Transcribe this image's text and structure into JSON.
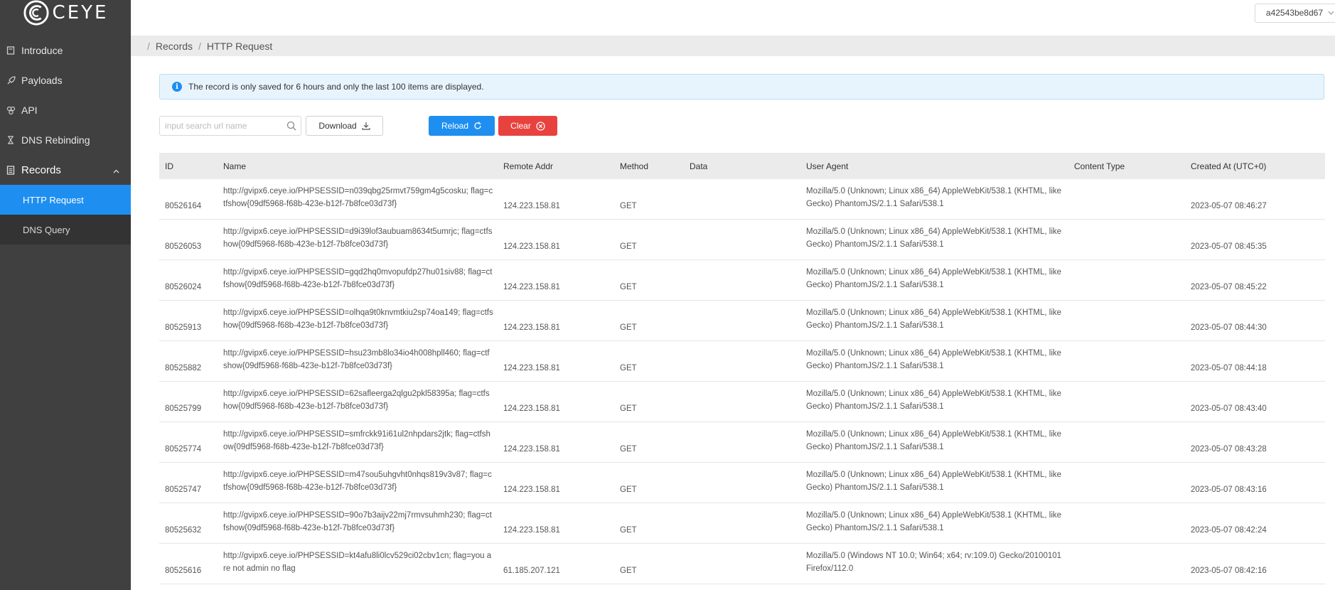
{
  "brand": {
    "name": "CEYE"
  },
  "sidebar": {
    "items": [
      {
        "label": "Introduce",
        "icon": "book-icon"
      },
      {
        "label": "Payloads",
        "icon": "rocket-icon"
      },
      {
        "label": "API",
        "icon": "api-icon"
      },
      {
        "label": "DNS Rebinding",
        "icon": "hourglass-icon"
      }
    ],
    "group": {
      "label": "Records",
      "icon": "records-icon",
      "expanded": true,
      "children": [
        {
          "label": "HTTP Request",
          "active": true
        },
        {
          "label": "DNS Query",
          "active": false
        }
      ]
    }
  },
  "header": {
    "user": "a42543be8d67"
  },
  "breadcrumb": {
    "sep": "/",
    "items": [
      "Records",
      "HTTP Request"
    ]
  },
  "alert": {
    "text": "The record is only saved for 6 hours and only the last 100 items are displayed."
  },
  "toolbar": {
    "search_placeholder": "input search url name",
    "download_label": "Download",
    "reload_label": "Reload",
    "clear_label": "Clear"
  },
  "colors": {
    "accent": "#1e8ff0",
    "danger": "#e8423e",
    "sidebar": "#404040"
  },
  "table": {
    "columns": [
      "ID",
      "Name",
      "Remote Addr",
      "Method",
      "Data",
      "User Agent",
      "Content Type",
      "Created At (UTC+0)"
    ],
    "rows": [
      {
        "id": "80526164",
        "name": "http://gvipx6.ceye.io/PHPSESSID=n039qbg25rmvt759gm4g5cosku; flag=ctfshow{09df5968-f68b-423e-b12f-7b8fce03d73f}",
        "addr": "124.223.158.81",
        "method": "GET",
        "data": "",
        "ua": "Mozilla/5.0 (Unknown; Linux x86_64) AppleWebKit/538.1 (KHTML, like Gecko) PhantomJS/2.1.1 Safari/538.1",
        "ct": "",
        "created": "2023-05-07 08:46:27"
      },
      {
        "id": "80526053",
        "name": "http://gvipx6.ceye.io/PHPSESSID=d9i39lof3aubuam8634t5umrjc; flag=ctfshow{09df5968-f68b-423e-b12f-7b8fce03d73f}",
        "addr": "124.223.158.81",
        "method": "GET",
        "data": "",
        "ua": "Mozilla/5.0 (Unknown; Linux x86_64) AppleWebKit/538.1 (KHTML, like Gecko) PhantomJS/2.1.1 Safari/538.1",
        "ct": "",
        "created": "2023-05-07 08:45:35"
      },
      {
        "id": "80526024",
        "name": "http://gvipx6.ceye.io/PHPSESSID=gqd2hq0mvopufdp27hu01siv88; flag=ctfshow{09df5968-f68b-423e-b12f-7b8fce03d73f}",
        "addr": "124.223.158.81",
        "method": "GET",
        "data": "",
        "ua": "Mozilla/5.0 (Unknown; Linux x86_64) AppleWebKit/538.1 (KHTML, like Gecko) PhantomJS/2.1.1 Safari/538.1",
        "ct": "",
        "created": "2023-05-07 08:45:22"
      },
      {
        "id": "80525913",
        "name": "http://gvipx6.ceye.io/PHPSESSID=olhqa9t0knvmtkiu2sp74oa149; flag=ctfshow{09df5968-f68b-423e-b12f-7b8fce03d73f}",
        "addr": "124.223.158.81",
        "method": "GET",
        "data": "",
        "ua": "Mozilla/5.0 (Unknown; Linux x86_64) AppleWebKit/538.1 (KHTML, like Gecko) PhantomJS/2.1.1 Safari/538.1",
        "ct": "",
        "created": "2023-05-07 08:44:30"
      },
      {
        "id": "80525882",
        "name": "http://gvipx6.ceye.io/PHPSESSID=hsu23mb8lo34io4h008hpll460; flag=ctfshow{09df5968-f68b-423e-b12f-7b8fce03d73f}",
        "addr": "124.223.158.81",
        "method": "GET",
        "data": "",
        "ua": "Mozilla/5.0 (Unknown; Linux x86_64) AppleWebKit/538.1 (KHTML, like Gecko) PhantomJS/2.1.1 Safari/538.1",
        "ct": "",
        "created": "2023-05-07 08:44:18"
      },
      {
        "id": "80525799",
        "name": "http://gvipx6.ceye.io/PHPSESSID=62safleerga2qlgu2pkl58395a; flag=ctfshow{09df5968-f68b-423e-b12f-7b8fce03d73f}",
        "addr": "124.223.158.81",
        "method": "GET",
        "data": "",
        "ua": "Mozilla/5.0 (Unknown; Linux x86_64) AppleWebKit/538.1 (KHTML, like Gecko) PhantomJS/2.1.1 Safari/538.1",
        "ct": "",
        "created": "2023-05-07 08:43:40"
      },
      {
        "id": "80525774",
        "name": "http://gvipx6.ceye.io/PHPSESSID=smfrckk91i61ul2nhpdars2jtk; flag=ctfshow{09df5968-f68b-423e-b12f-7b8fce03d73f}",
        "addr": "124.223.158.81",
        "method": "GET",
        "data": "",
        "ua": "Mozilla/5.0 (Unknown; Linux x86_64) AppleWebKit/538.1 (KHTML, like Gecko) PhantomJS/2.1.1 Safari/538.1",
        "ct": "",
        "created": "2023-05-07 08:43:28"
      },
      {
        "id": "80525747",
        "name": "http://gvipx6.ceye.io/PHPSESSID=m47sou5uhgvht0nhqs819v3v87; flag=ctfshow{09df5968-f68b-423e-b12f-7b8fce03d73f}",
        "addr": "124.223.158.81",
        "method": "GET",
        "data": "",
        "ua": "Mozilla/5.0 (Unknown; Linux x86_64) AppleWebKit/538.1 (KHTML, like Gecko) PhantomJS/2.1.1 Safari/538.1",
        "ct": "",
        "created": "2023-05-07 08:43:16"
      },
      {
        "id": "80525632",
        "name": "http://gvipx6.ceye.io/PHPSESSID=90o7b3aijv22mj7rmvsuhmh230; flag=ctfshow{09df5968-f68b-423e-b12f-7b8fce03d73f}",
        "addr": "124.223.158.81",
        "method": "GET",
        "data": "",
        "ua": "Mozilla/5.0 (Unknown; Linux x86_64) AppleWebKit/538.1 (KHTML, like Gecko) PhantomJS/2.1.1 Safari/538.1",
        "ct": "",
        "created": "2023-05-07 08:42:24"
      },
      {
        "id": "80525616",
        "name": "http://gvipx6.ceye.io/PHPSESSID=kt4afu8li0lcv529ci02cbv1cn; flag=you are not admin no flag",
        "addr": "61.185.207.121",
        "method": "GET",
        "data": "",
        "ua": "Mozilla/5.0 (Windows NT 10.0; Win64; x64; rv:109.0) Gecko/20100101 Firefox/112.0",
        "ct": "",
        "created": "2023-05-07 08:42:16"
      }
    ]
  }
}
